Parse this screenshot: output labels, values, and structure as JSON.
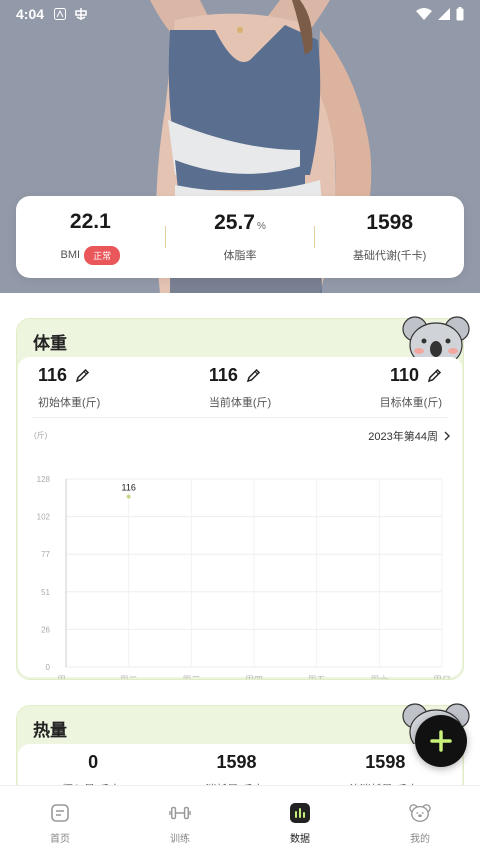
{
  "status_bar": {
    "time": "4:04"
  },
  "metrics": [
    {
      "value": "22.1",
      "unit": "",
      "label": "BMI",
      "badge": "正常"
    },
    {
      "value": "25.7",
      "unit": "%",
      "label": "体脂率"
    },
    {
      "value": "1598",
      "unit": "",
      "label": "基础代谢(千卡)"
    }
  ],
  "weight_card": {
    "title": "体重",
    "initial": {
      "value": "116",
      "label": "初始体重(斤)"
    },
    "current": {
      "value": "116",
      "label": "当前体重(斤)"
    },
    "target": {
      "value": "110",
      "label": "目标体重(斤)"
    },
    "unit_label": "(斤)",
    "week_label": "2023年第44周"
  },
  "chart_data": {
    "type": "line",
    "categories": [
      "周一",
      "周二",
      "周三",
      "周四",
      "周五",
      "周六",
      "周日"
    ],
    "y_ticks": [
      "128",
      "102",
      "77",
      "51",
      "26",
      "0"
    ],
    "ylim": [
      0,
      128
    ],
    "ylabel": "(斤)",
    "series": [
      {
        "values": [
          null,
          116,
          null,
          null,
          null,
          null,
          null
        ],
        "point_labels": [
          "",
          "116",
          "",
          "",
          "",
          "",
          ""
        ]
      }
    ],
    "point_color": "#c9d68a"
  },
  "calorie_card": {
    "title": "热量",
    "items": [
      {
        "value": "0",
        "label": "摄入量(千卡)"
      },
      {
        "value": "1598",
        "label": "消耗量(千卡)"
      },
      {
        "value": "1598",
        "label": "待消耗量(千卡)"
      }
    ]
  },
  "bottom_nav": [
    {
      "label": "首页",
      "icon": "home-icon"
    },
    {
      "label": "训练",
      "icon": "dumbbell-icon"
    },
    {
      "label": "数据",
      "icon": "chart-icon"
    },
    {
      "label": "我的",
      "icon": "profile-icon"
    }
  ],
  "colors": {
    "accent": "#eef5df",
    "badge": "#e9575a",
    "fab": "#111111",
    "fab_plus": "#c8f07a"
  }
}
